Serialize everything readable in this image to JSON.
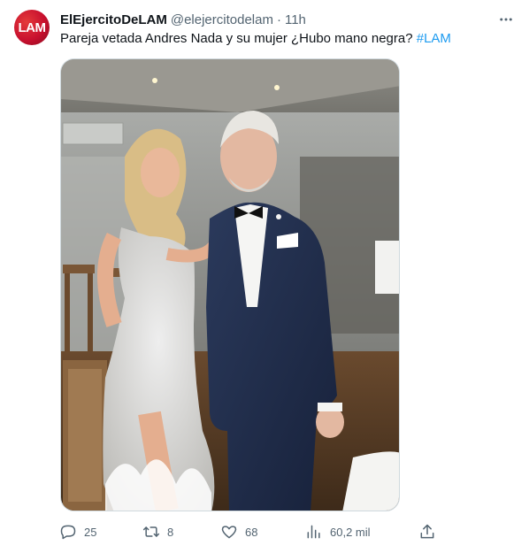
{
  "author": {
    "avatar_text": "LAM",
    "display_name": "ElEjercitoDeLAM",
    "handle": "@elejercitodelam",
    "separator": "·",
    "time": "11h"
  },
  "tweet": {
    "text": "Pareja vetada Andres Nada y su mujer  ¿Hubo mano negra? ",
    "hashtag": "#LAM"
  },
  "media": {
    "description": "photo-couple-event"
  },
  "actions": {
    "replies": "25",
    "retweets": "8",
    "likes": "68",
    "views": "60,2 mil"
  },
  "colors": {
    "accent": "#1d9bf0",
    "secondary_text": "#536471",
    "avatar": "#c8102e"
  },
  "icons": [
    "more-icon",
    "reply-icon",
    "retweet-icon",
    "like-icon",
    "views-icon",
    "share-icon"
  ]
}
